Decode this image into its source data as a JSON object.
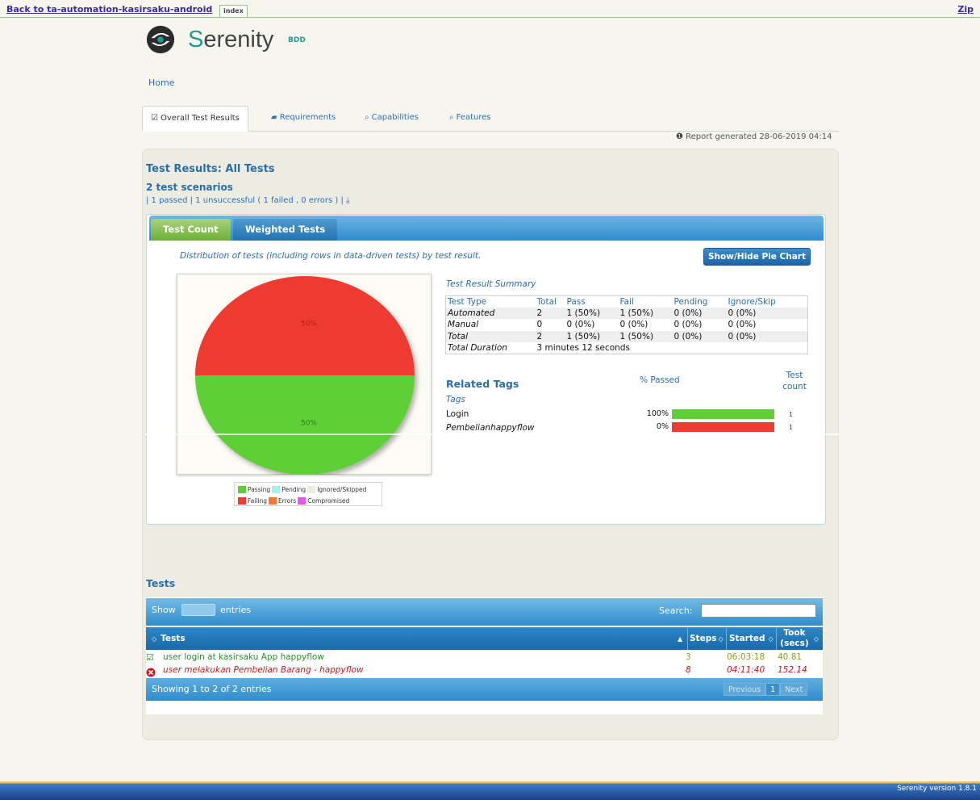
{
  "topbar": {
    "back_link": "Back to ta-automation-kasirsaku-android",
    "index_tab": "index",
    "zip_link": "Zip"
  },
  "logo": {
    "text_s": "S",
    "text_erenity": "erenity",
    "bdd": "BDD"
  },
  "nav": {
    "home": "Home"
  },
  "tabs": [
    {
      "label": "Overall Test Results",
      "icon": "checkbox-icon"
    },
    {
      "label": "Requirements",
      "icon": "book-icon"
    },
    {
      "label": "Capabilities",
      "icon": "chat-icon"
    },
    {
      "label": "Features",
      "icon": "chat-icon"
    }
  ],
  "report_generated": "Report generated 28-06-2019 04:14",
  "results": {
    "title": "Test Results: All Tests",
    "scenario_count": "2 test scenarios",
    "breakdown": "| 1 passed | 1 unsuccessful ( 1 failed , 0 errors ) |"
  },
  "chart_tabs": {
    "count": "Test Count",
    "weighted": "Weighted Tests"
  },
  "distribution_text": "Distribution of tests (including rows in data-driven tests) by test result.",
  "pie_toggle_label": "Show/Hide Pie Chart",
  "chart_data": {
    "type": "pie",
    "slices": [
      {
        "label": "Failing",
        "value": 50,
        "display": "50%",
        "color": "#ee3a33"
      },
      {
        "label": "Passing",
        "value": 50,
        "display": "50%",
        "color": "#5fcf38"
      }
    ],
    "legend": [
      {
        "label": "Passing",
        "color": "#5fcf38"
      },
      {
        "label": "Pending",
        "color": "#aaeeee"
      },
      {
        "label": "Ignored/Skipped",
        "color": "#eeeedd"
      },
      {
        "label": "Failing",
        "color": "#ee3a33"
      },
      {
        "label": "Errors",
        "color": "#f0783a"
      },
      {
        "label": "Compromised",
        "color": "#e05ae8"
      }
    ]
  },
  "summary": {
    "title": "Test Result Summary",
    "headers": [
      "Test Type",
      "Total",
      "Pass",
      "Fail",
      "Pending",
      "Ignore/Skip"
    ],
    "rows": [
      [
        "Automated",
        "2",
        "1 (50%)",
        "1 (50%)",
        "0 (0%)",
        "0 (0%)"
      ],
      [
        "Manual",
        "0",
        "0 (0%)",
        "0 (0%)",
        "0 (0%)",
        "0 (0%)"
      ],
      [
        "Total",
        "2",
        "1 (50%)",
        "1 (50%)",
        "0 (0%)",
        "0 (0%)"
      ]
    ],
    "duration_label": "Total Duration",
    "duration_value": "3 minutes 12 seconds"
  },
  "tags": {
    "title": "Related Tags",
    "pct_header": "% Passed",
    "count_header": "Test count",
    "section_label": "Tags",
    "items": [
      {
        "name": "Login",
        "pct": "100%",
        "count": "1",
        "passed_fraction": 1.0,
        "color": "#5fcf38"
      },
      {
        "name": "Pembelianhappyflow",
        "pct": "0%",
        "count": "1",
        "passed_fraction": 0.0,
        "color": "#ee3a33"
      }
    ]
  },
  "tests": {
    "title": "Tests",
    "show_label": "Show",
    "entries_label": "entries",
    "search_label": "Search:",
    "headers": {
      "tests": "Tests",
      "steps": "Steps",
      "started": "Started",
      "took": "Took (secs)"
    },
    "rows": [
      {
        "name": "user login at kasirsaku App happyflow",
        "steps": "3",
        "started": "06:03:18",
        "took": "40.81",
        "status": "passed"
      },
      {
        "name": "user melakukan Pembelian Barang - happyflow",
        "steps": "8",
        "started": "04:11:40",
        "took": "152.14",
        "status": "failed"
      }
    ],
    "showing": "Showing 1 to 2 of 2 entries",
    "pager": {
      "previous": "Previous",
      "page": "1",
      "next": "Next"
    }
  },
  "footer": {
    "version": "Serenity version 1.8.1"
  },
  "colors": {
    "accent": "#2a6da8",
    "pass": "#5fcf38",
    "fail": "#ee3a33",
    "brand": "#1f9e8f"
  }
}
